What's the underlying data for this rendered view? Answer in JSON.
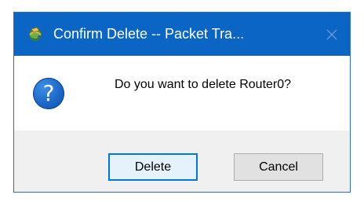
{
  "window": {
    "title": "Confirm Delete -- Packet Tra...",
    "app_icon": "packet-tracer-icon",
    "close_icon": "close-icon"
  },
  "dialog": {
    "icon": "question-icon",
    "icon_glyph": "?",
    "message": "Do you want to delete Router0?"
  },
  "buttons": {
    "delete_label": "Delete",
    "cancel_label": "Cancel"
  },
  "colors": {
    "titlebar": "#0a65c4",
    "default_button_border": "#0078d7",
    "button_bar": "#f0f0f0"
  }
}
